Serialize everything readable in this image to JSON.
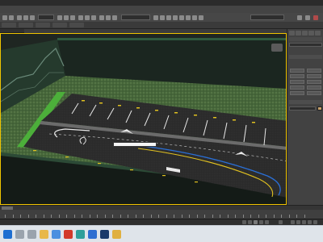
{
  "window": {
    "title": ""
  },
  "menu": [
    {
      "label": ""
    },
    {
      "label": ""
    },
    {
      "label": ""
    },
    {
      "label": ""
    },
    {
      "label": ""
    },
    {
      "label": ""
    },
    {
      "label": ""
    },
    {
      "label": ""
    },
    {
      "label": ""
    },
    {
      "label": ""
    },
    {
      "label": ""
    },
    {
      "label": ""
    },
    {
      "label": ""
    },
    {
      "label": ""
    },
    {
      "label": ""
    }
  ],
  "toolbar": {
    "selection_set_value": "",
    "workspace_value": ""
  },
  "ribbon": {
    "tabs": [
      {
        "label": ""
      },
      {
        "label": ""
      },
      {
        "label": ""
      },
      {
        "label": ""
      },
      {
        "label": ""
      }
    ]
  },
  "viewport": {
    "label": "",
    "cursor_tooltip": ""
  },
  "command_panel": {
    "dropdown_value": "",
    "object_type_header": "",
    "object_buttons": [
      {
        "label": ""
      },
      {
        "label": ""
      },
      {
        "label": ""
      },
      {
        "label": ""
      },
      {
        "label": ""
      },
      {
        "label": ""
      },
      {
        "label": ""
      },
      {
        "label": ""
      },
      {
        "label": ""
      },
      {
        "label": ""
      }
    ],
    "name_color_header": "",
    "color_swatch": "#c9a26b"
  },
  "status": {
    "selection_text": "",
    "prompt_text": ""
  },
  "colors": {
    "accent_selection": "#f0c400",
    "grass": "#4a6b3a",
    "asphalt": "#2a2a2a",
    "wall": "#1e2a24",
    "green_curb": "#4caf3a",
    "lane_blue": "#2a6fd6",
    "lane_yellow": "#e0c020"
  },
  "taskbar": {
    "icons": [
      {
        "icon": "windows-start-icon"
      },
      {
        "icon": "search-icon"
      },
      {
        "icon": "task-view-icon"
      },
      {
        "icon": "file-explorer-icon"
      },
      {
        "icon": "chrome-icon"
      },
      {
        "icon": "acrobat-icon"
      },
      {
        "icon": "3dsmax-icon"
      },
      {
        "icon": "mail-icon"
      },
      {
        "icon": "photoshop-icon"
      },
      {
        "icon": "folder-icon"
      }
    ],
    "tray_weather": "",
    "clock_time": "",
    "clock_date": ""
  }
}
